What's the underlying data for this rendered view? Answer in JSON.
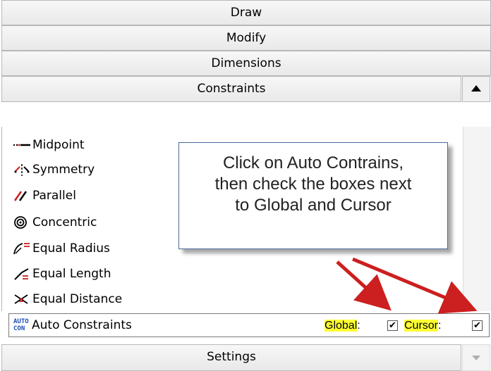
{
  "sections": {
    "draw": "Draw",
    "modify": "Modify",
    "dimensions": "Dimensions",
    "constraints": "Constraints",
    "settings": "Settings"
  },
  "tools": [
    {
      "label": "Midpoint",
      "icon": "midpoint-icon"
    },
    {
      "label": "Symmetry",
      "icon": "symmetry-icon"
    },
    {
      "label": "Parallel",
      "icon": "parallel-icon"
    },
    {
      "label": "Concentric",
      "icon": "concentric-icon"
    },
    {
      "label": "Equal Radius",
      "icon": "equal-radius-icon"
    },
    {
      "label": "Equal Length",
      "icon": "equal-length-icon"
    },
    {
      "label": "Equal Distance",
      "icon": "equal-distance-icon"
    }
  ],
  "auto_constraints": {
    "label": "Auto Constraints",
    "icon_text_top": "AUTO",
    "icon_text_bottom": "CON",
    "global_label": "Global",
    "global_colon": ":",
    "global_checked": true,
    "cursor_label": "Cursor",
    "cursor_colon": ":",
    "cursor_checked": true,
    "check_mark": "✔"
  },
  "callout": {
    "line1": "Click on Auto Contrains,",
    "line2": "then check the boxes next",
    "line3": "to Global and Cursor"
  },
  "colors": {
    "highlight": "#ffff33",
    "arrow": "#cc1f1f",
    "icon_blue": "#1a4fb8"
  }
}
